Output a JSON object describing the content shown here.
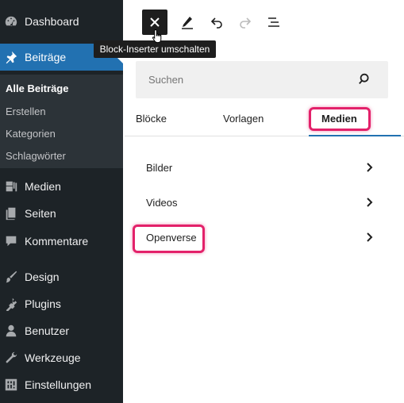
{
  "sidebar": {
    "items": [
      {
        "label": "Dashboard",
        "icon": "dashboard-icon"
      },
      {
        "label": "Beiträge",
        "icon": "pin-icon",
        "active": true
      },
      {
        "label": "Medien",
        "icon": "media-icon"
      },
      {
        "label": "Seiten",
        "icon": "pages-icon"
      },
      {
        "label": "Kommentare",
        "icon": "comments-icon"
      },
      {
        "label": "Design",
        "icon": "brush-icon"
      },
      {
        "label": "Plugins",
        "icon": "plugins-icon"
      },
      {
        "label": "Benutzer",
        "icon": "users-icon"
      },
      {
        "label": "Werkzeuge",
        "icon": "wrench-icon"
      },
      {
        "label": "Einstellungen",
        "icon": "settings-icon"
      }
    ],
    "submenu": [
      "Alle Beiträge",
      "Erstellen",
      "Kategorien",
      "Schlagwörter"
    ]
  },
  "toolbar": {
    "tooltip": "Block-Inserter umschalten"
  },
  "inserter": {
    "search_placeholder": "Suchen",
    "tabs": [
      "Blöcke",
      "Vorlagen",
      "Medien"
    ],
    "active_tab": "Medien",
    "categories": [
      "Bilder",
      "Videos",
      "Openverse"
    ]
  },
  "colors": {
    "sidebar_bg": "#1d2327",
    "accent": "#2271b1",
    "highlight": "#e3216a"
  }
}
